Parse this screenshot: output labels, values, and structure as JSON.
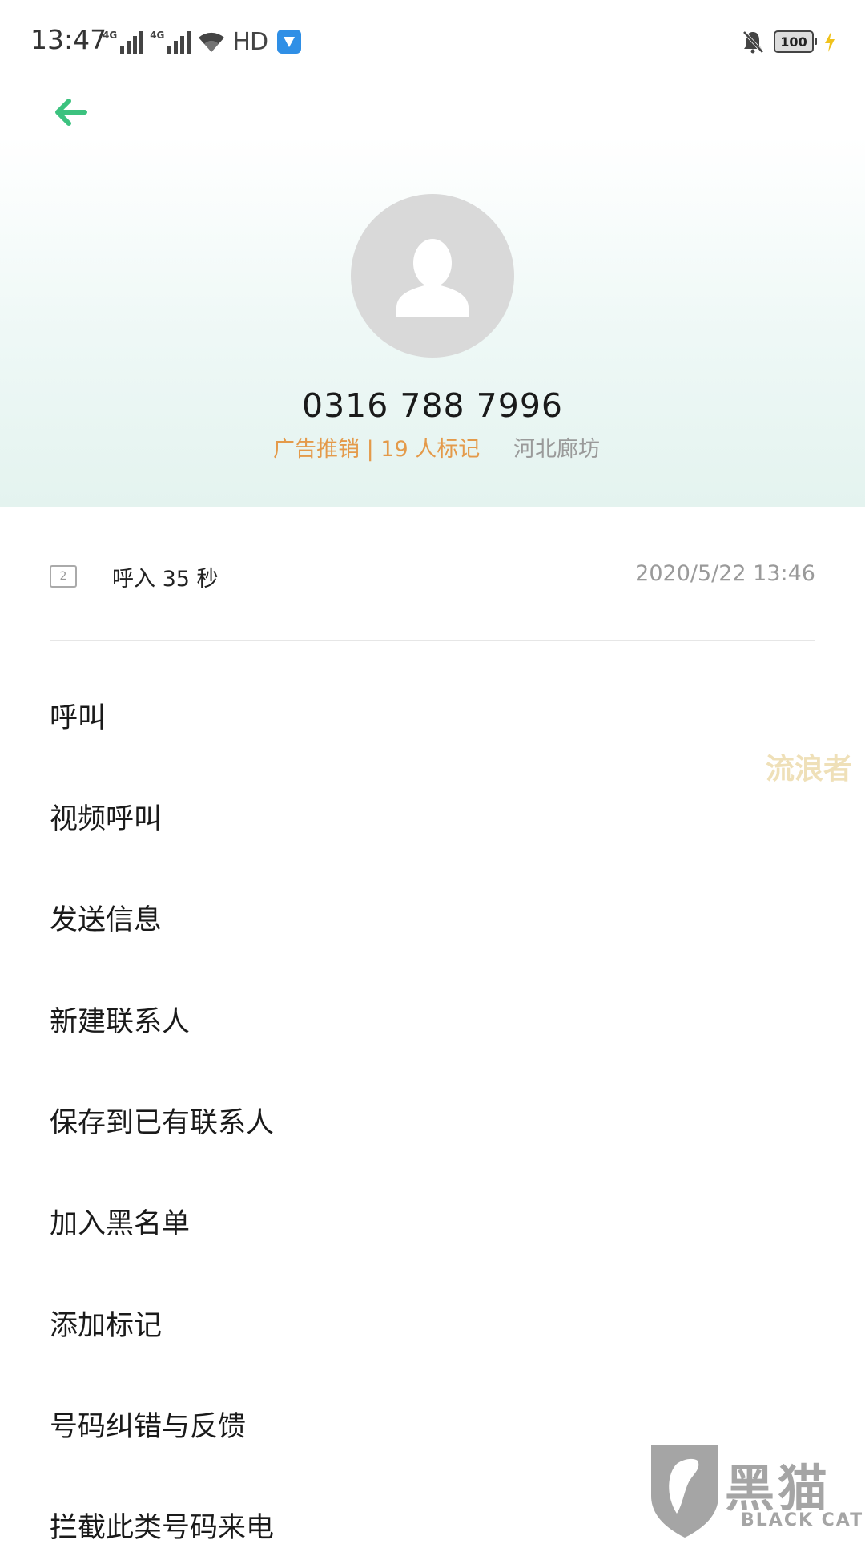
{
  "status_bar": {
    "time": "13:47",
    "signal1_label": "4G",
    "signal2_label": "4G",
    "hd_label": "HD",
    "battery_level": "100",
    "icons": [
      "signal-icon",
      "signal-icon",
      "wifi-icon",
      "hd-icon",
      "app-notification-icon",
      "mute-icon",
      "battery-icon",
      "charging-icon"
    ]
  },
  "header": {
    "back_icon": "back-arrow-icon",
    "accent_color": "#3cc27f"
  },
  "contact": {
    "avatar_icon": "person-avatar-icon",
    "phone_number": "0316 788 7996",
    "tag": "广告推销 | 19 人标记",
    "location": "河北廊坊",
    "tag_color": "#e49a4a"
  },
  "call_record": {
    "sim_label": "2",
    "label": "呼入  35 秒",
    "timestamp": "2020/5/22 13:46"
  },
  "menu": {
    "items": [
      "呼叫",
      "视频呼叫",
      "发送信息",
      "新建联系人",
      "保存到已有联系人",
      "加入黑名单",
      "添加标记",
      "号码纠错与反馈",
      "拦截此类号码来电"
    ]
  },
  "watermarks": {
    "side_text": "流浪者",
    "logo_cn": "黑猫",
    "logo_en": "BLACK CAT"
  }
}
